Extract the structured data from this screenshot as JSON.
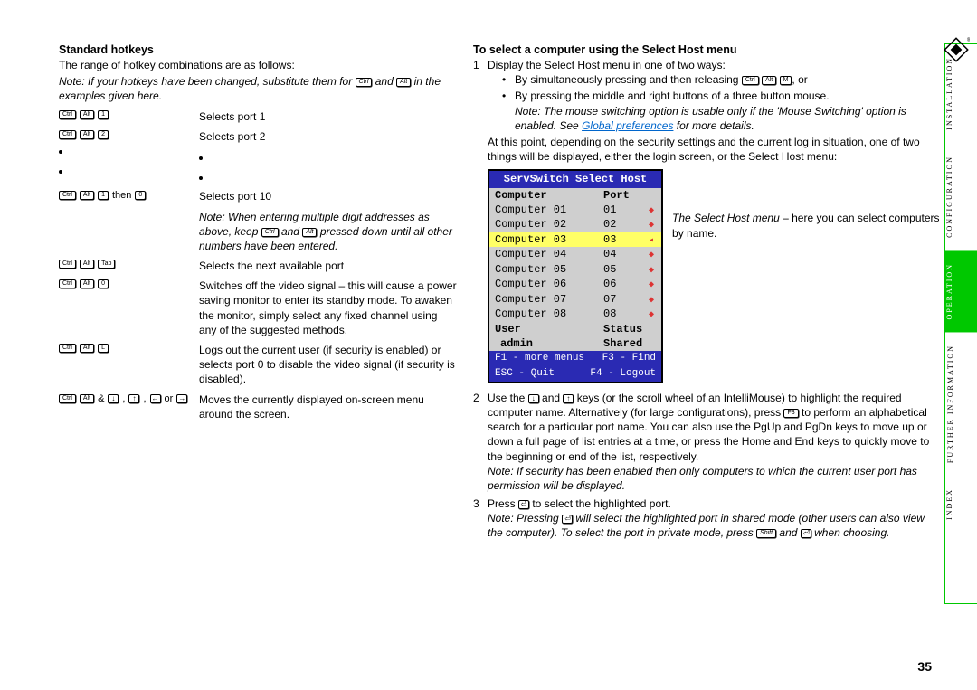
{
  "page_number": "35",
  "left": {
    "heading": "Standard hotkeys",
    "intro": "The range of hotkey combinations are as follows:",
    "note1_a": "Note: If your hotkeys have been changed, substitute them for ",
    "note1_b": " and ",
    "note1_c": " in the examples given here.",
    "rows": [
      {
        "keys": [
          "Ctrl",
          "Alt",
          "1"
        ],
        "desc": "Selects port 1"
      },
      {
        "keys": [
          "Ctrl",
          "Alt",
          "2"
        ],
        "desc": "Selects port 2"
      }
    ],
    "row10_then": "then",
    "row10_desc": "Selects port 10",
    "multi_note": "Note: When entering multiple digit addresses as above, keep ",
    "multi_note_mid": " and ",
    "multi_note_end": " pressed down until all other numbers have been entered.",
    "row_tab_desc": "Selects the next available port",
    "row_0_desc": "Switches off the video signal – this will cause a power saving monitor to enter its standby mode. To awaken the monitor, simply select any fixed channel using any of the suggested methods.",
    "row_L_desc": "Logs out the current user (if security is enabled) or selects port 0 to disable the video signal (if security is disabled).",
    "row_arrows_join": " & ",
    "row_arrows_sep": ", ",
    "row_arrows_or": " or ",
    "row_arrows_desc": "Moves the currently displayed on-screen menu around the screen."
  },
  "right": {
    "heading": "To select a computer using the Select Host menu",
    "step1": "Display the Select Host menu in one of two ways:",
    "bullet1_a": "By simultaneously pressing and then releasing ",
    "bullet1_b": ", or",
    "bullet2": "By pressing the middle and right buttons of a three button mouse.",
    "bullet2_note_a": "Note: The mouse switching option is usable only if the 'Mouse Switching' option is enabled. See ",
    "bullet2_note_link": "Global preferences",
    "bullet2_note_b": " for more details.",
    "after_bullets": "At this point, depending on the security settings and the current log in situation, one of two things will be displayed, either the login screen, or the Select Host menu:",
    "hostmenu": {
      "title": "ServSwitch Select Host",
      "hdr_computer": "Computer",
      "hdr_port": "Port",
      "rows": [
        {
          "name": "Computer 01",
          "port": "01",
          "mark": "diamond"
        },
        {
          "name": "Computer 02",
          "port": "02",
          "mark": "diamond"
        },
        {
          "name": "Computer 03",
          "port": "03",
          "mark": "triangle",
          "hi": true
        },
        {
          "name": "Computer 04",
          "port": "04",
          "mark": "diamond"
        },
        {
          "name": "Computer 05",
          "port": "05",
          "mark": "diamond"
        },
        {
          "name": "Computer 06",
          "port": "06",
          "mark": "diamond"
        },
        {
          "name": "Computer 07",
          "port": "07",
          "mark": "diamond"
        },
        {
          "name": "Computer 08",
          "port": "08",
          "mark": "diamond"
        }
      ],
      "user_label": "User",
      "status_label": "Status",
      "user_value": "admin",
      "status_value": "Shared",
      "footer_l1a": "F1 - more menus",
      "footer_l1b": "F3 - Find",
      "footer_l2a": "ESC - Quit",
      "footer_l2b": "F4 - Logout"
    },
    "caption_a": "The Select Host menu",
    "caption_b": " – here you can select computers by name.",
    "step2_a": "Use the ",
    "step2_b": " and ",
    "step2_c": " keys (or the scroll wheel of an IntelliMouse) to highlight the required computer name. Alternatively (for large configurations), press ",
    "step2_d": " to perform an alphabetical search for a particular port name. You can also use the PgUp and PgDn keys to move up or down a full page of list entries at a time, or press the Home and End keys to quickly move to the beginning or end of the list, respectively.",
    "step2_note": "Note: If security has been enabled then only computers to which the current user port has permission will be displayed.",
    "step3_a": "Press ",
    "step3_b": " to select the highlighted port.",
    "step3_note_a": "Note: Pressing ",
    "step3_note_b": " will select the highlighted port in shared mode (other users can also view the computer). To select the port in private mode, press ",
    "step3_note_c": " and ",
    "step3_note_d": " when choosing."
  },
  "nav": {
    "tabs": [
      {
        "label": "INSTALLATION",
        "active": false
      },
      {
        "label": "CONFIGURATION",
        "active": false
      },
      {
        "label": "OPERATION",
        "active": true
      },
      {
        "label": "FURTHER\nINFORMATION",
        "active": false,
        "double": true
      },
      {
        "label": "INDEX",
        "active": false
      }
    ]
  },
  "keys": {
    "ctrl": "Ctrl",
    "alt": "Alt",
    "tab": "Tab",
    "shift": "Shift",
    "m": "M",
    "l": "L",
    "f3": "F3",
    "zero": "0",
    "one": "1",
    "two": "2"
  }
}
